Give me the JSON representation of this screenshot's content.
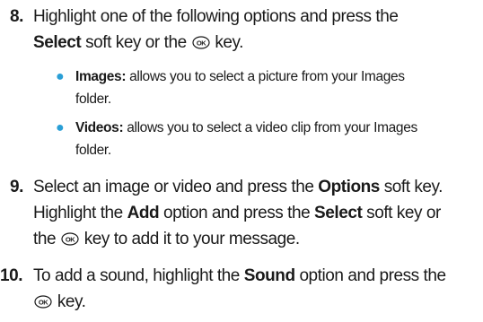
{
  "step8": {
    "number": "8.",
    "t1": "Highlight one of the following options and press the",
    "select": "Select",
    "t2": " soft key or the ",
    "t3": " key.",
    "bullets": [
      {
        "term": "Images:",
        "desc": " allows you to select a picture from your Images",
        "desc2": "folder."
      },
      {
        "term": "Videos:",
        "desc": " allows you to select a video clip from your Images",
        "desc2": "folder."
      }
    ]
  },
  "step9": {
    "number": "9.",
    "t1": "Select an image or video and press the ",
    "options": "Options",
    "t2": " soft key.",
    "t3": "Highlight the ",
    "add": "Add",
    "t4": " option and press the ",
    "select": "Select",
    "t5": " soft key or",
    "t6": "the ",
    "t7": " key to add it to your message."
  },
  "step10": {
    "number": "10.",
    "t1": "To add a sound, highlight the ",
    "sound": "Sound",
    "t2": " option and press the",
    "t3": " key."
  },
  "icons": {
    "ok_key": "ok-key-icon",
    "ok_label": "OK"
  },
  "colors": {
    "bullet": "#2a9fd6",
    "text": "#1a1a1a"
  }
}
